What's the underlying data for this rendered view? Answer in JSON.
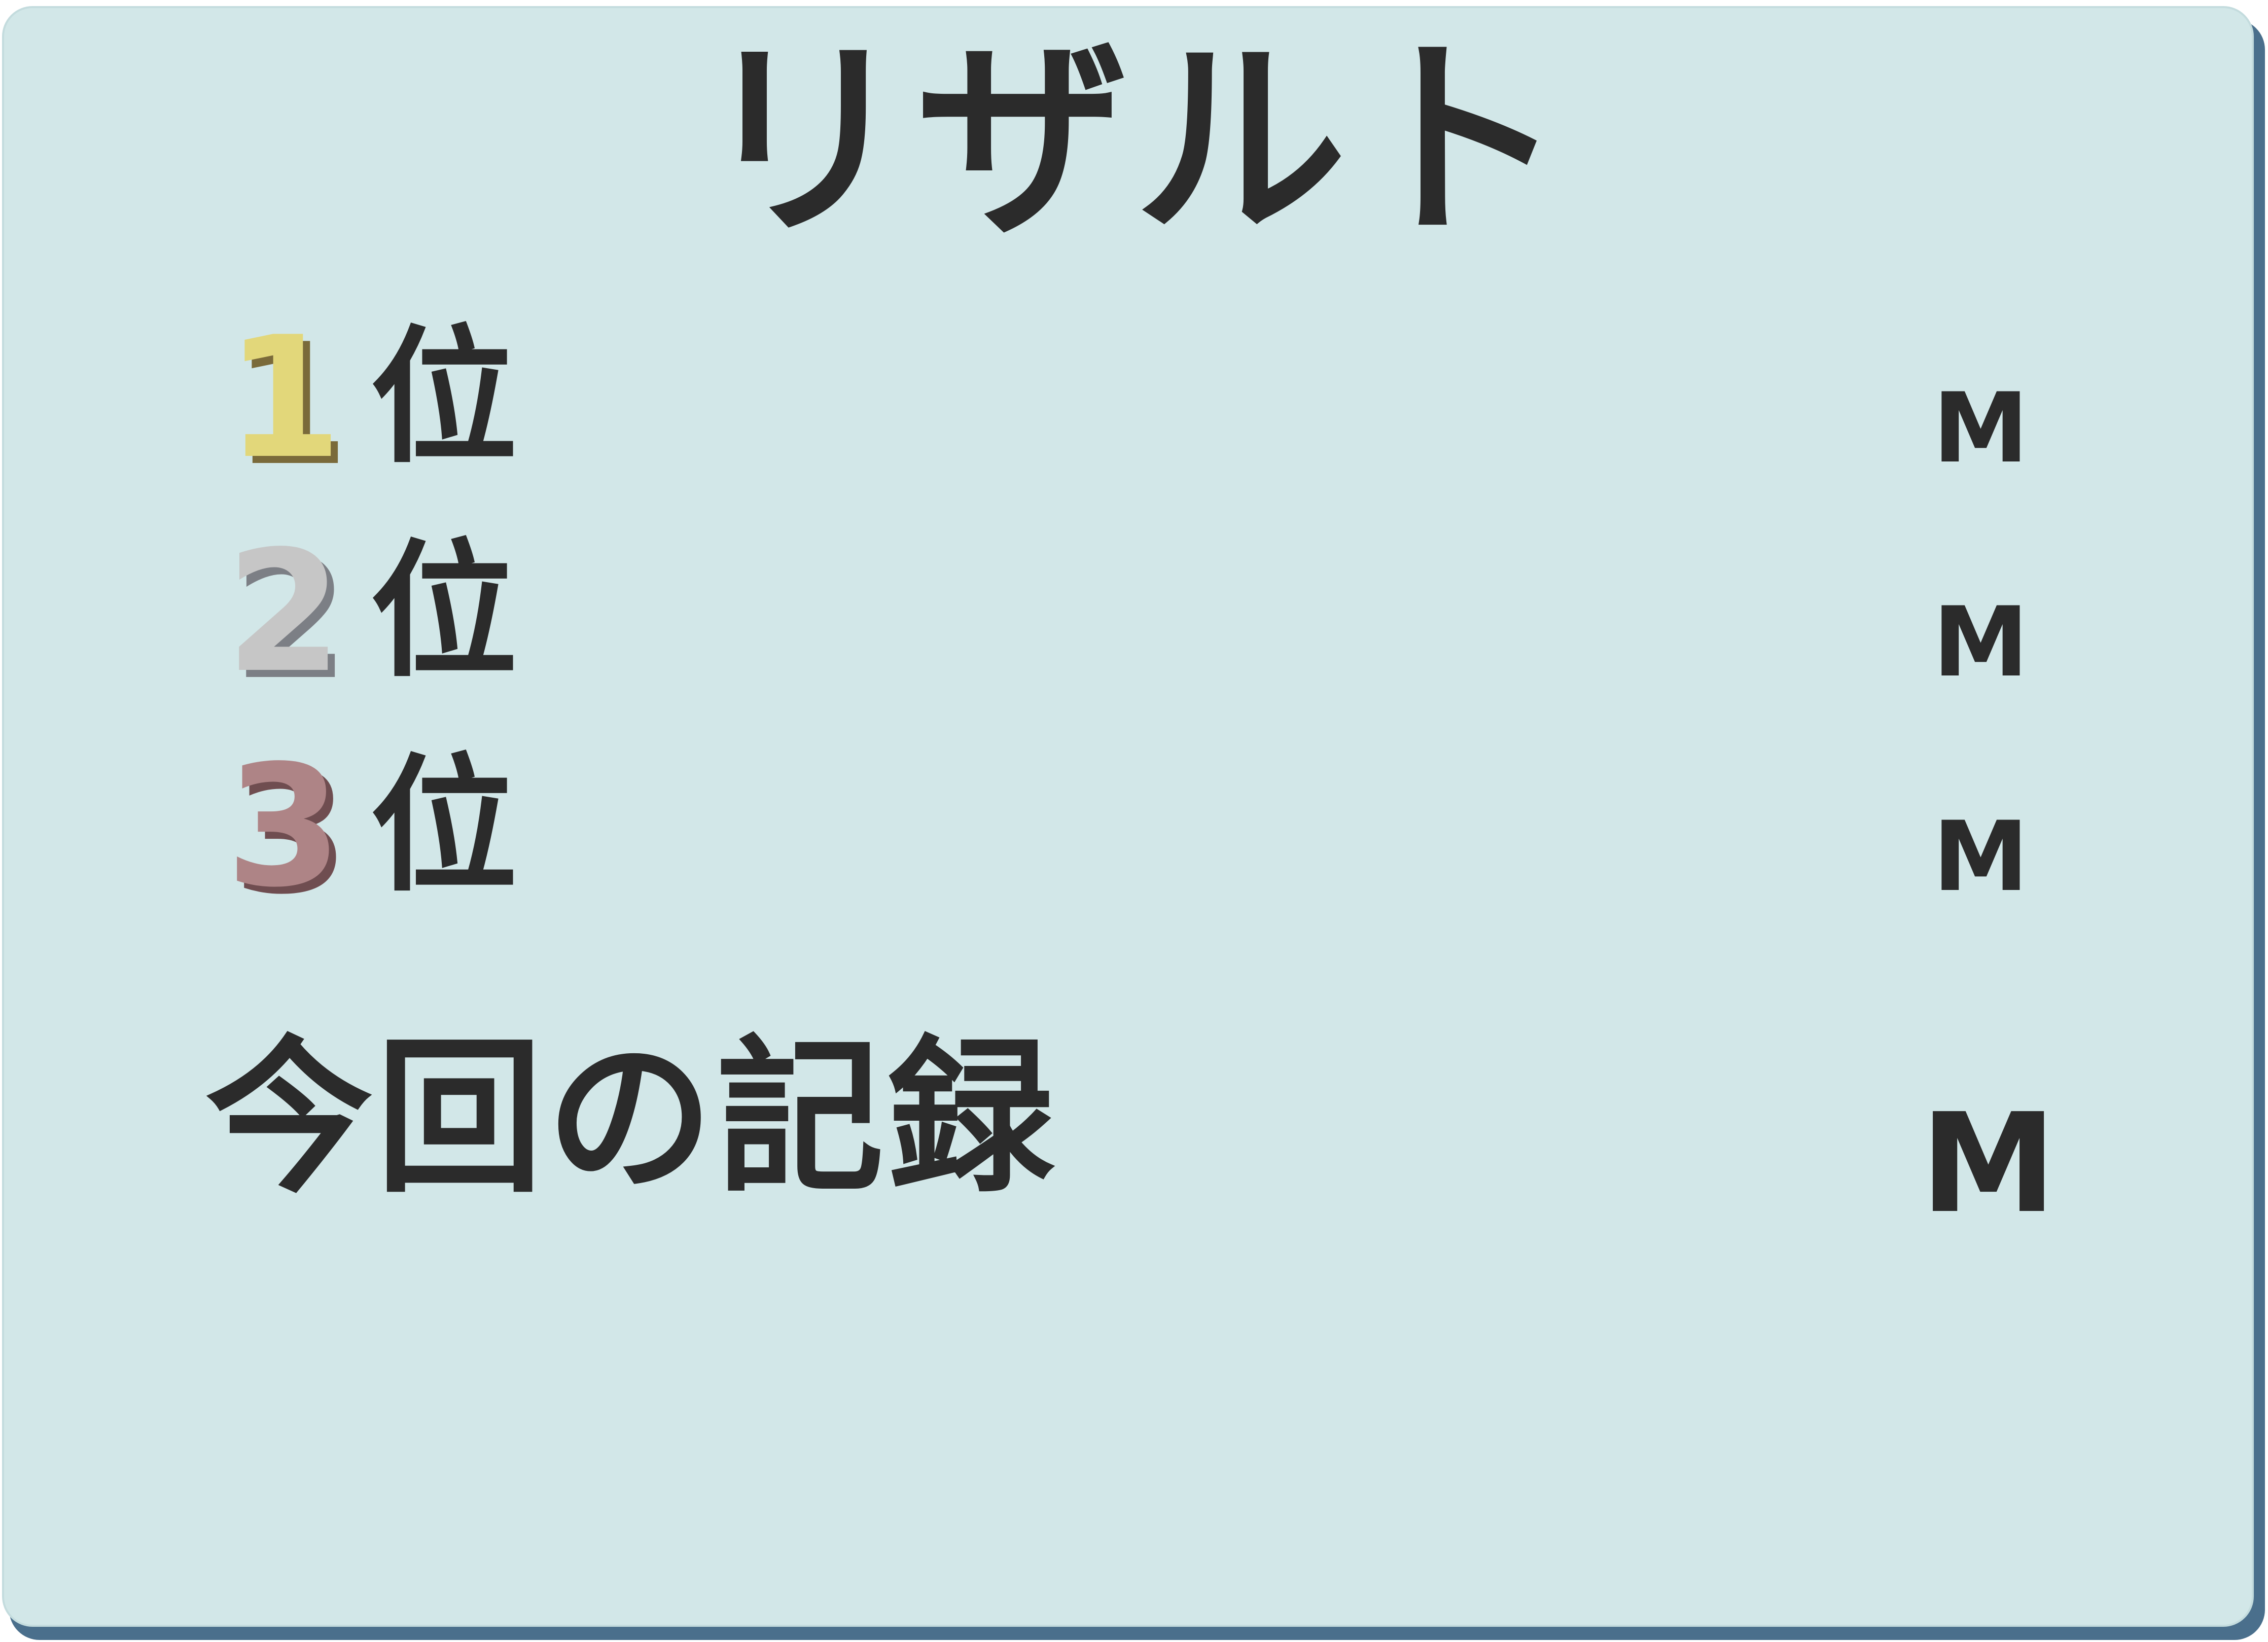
{
  "screen": {
    "title": "リザルト"
  },
  "rankings": [
    {
      "rank": "1",
      "suffix": "位",
      "value": "M",
      "color": "#e2d77a"
    },
    {
      "rank": "2",
      "suffix": "位",
      "value": "M",
      "color": "#c6c6c6"
    },
    {
      "rank": "3",
      "suffix": "位",
      "value": "M",
      "color": "#ae8486"
    }
  ],
  "current_record": {
    "label": "今回の記録",
    "value": "M"
  },
  "colors": {
    "panel_background": "#d2e7e8",
    "panel_shadow": "#4a6f8c",
    "text": "#2b2b2b"
  }
}
